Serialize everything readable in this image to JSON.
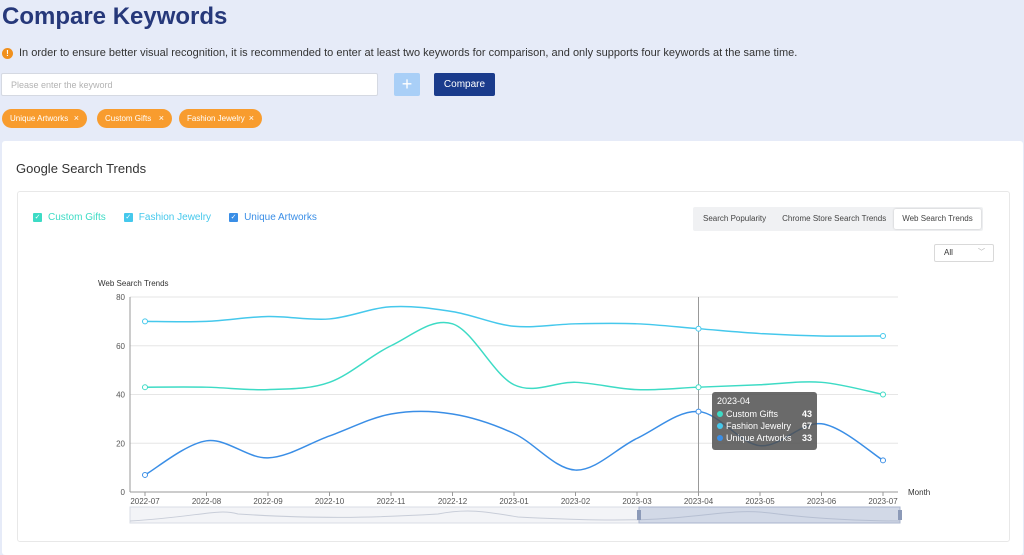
{
  "page": {
    "title": "Compare Keywords",
    "notice": "In order to ensure better visual recognition, it is recommended to enter at least two keywords for comparison, and only supports four keywords at the same time.",
    "notice_icon": "exclamation-icon"
  },
  "search": {
    "placeholder": "Please enter the keyword",
    "value": "",
    "add_label": "+",
    "compare_label": "Compare"
  },
  "tags": [
    {
      "label": "Unique Artworks",
      "remove": "×"
    },
    {
      "label": "Custom Gifts",
      "remove": "×"
    },
    {
      "label": "Fashion Jewelry",
      "remove": "×"
    }
  ],
  "card": {
    "title": "Google Search Trends",
    "legend": [
      {
        "label": "Custom Gifts",
        "checked": true,
        "color": "#3ddbc5",
        "check": "✓"
      },
      {
        "label": "Fashion Jewelry",
        "checked": true,
        "color": "#45c8ec",
        "check": "✓"
      },
      {
        "label": "Unique Artworks",
        "checked": true,
        "color": "#3a8ee6",
        "check": "✓"
      }
    ],
    "segmented": {
      "options": [
        "Search Popularity",
        "Chrome Store Search Trends",
        "Web Search Trends"
      ],
      "selected": "Web Search Trends"
    },
    "range_select": {
      "value": "All",
      "chevron": "﹀"
    }
  },
  "tooltip": {
    "title": "2023-04",
    "rows": [
      {
        "name": "Custom Gifts",
        "value": "43",
        "color": "#3ddbc5"
      },
      {
        "name": "Fashion Jewelry",
        "value": "67",
        "color": "#45c8ec"
      },
      {
        "name": "Unique Artworks",
        "value": "33",
        "color": "#3a8ee6"
      }
    ]
  },
  "chart_data": {
    "type": "line",
    "ylabel": "Web Search Trends",
    "xlabel": "Month",
    "ylim": [
      0,
      80
    ],
    "yticks": [
      0,
      20,
      40,
      60,
      80
    ],
    "grid": true,
    "x": [
      "2022-07",
      "2022-08",
      "2022-09",
      "2022-10",
      "2022-11",
      "2022-12",
      "2023-01",
      "2023-02",
      "2023-03",
      "2023-04",
      "2023-05",
      "2023-06",
      "2023-07"
    ],
    "highlight_index": 9,
    "series": [
      {
        "name": "Custom Gifts",
        "color": "#3ddbc5",
        "values": [
          43,
          43,
          42,
          45,
          60,
          69,
          44,
          45,
          42,
          43,
          44,
          45,
          40
        ]
      },
      {
        "name": "Fashion Jewelry",
        "color": "#45c8ec",
        "values": [
          70,
          70,
          72,
          71,
          76,
          74,
          68,
          69,
          69,
          67,
          65,
          64,
          64
        ]
      },
      {
        "name": "Unique Artworks",
        "color": "#3a8ee6",
        "values": [
          7,
          21,
          14,
          23,
          32,
          32,
          24,
          9,
          22,
          33,
          19,
          28,
          13
        ]
      }
    ]
  }
}
